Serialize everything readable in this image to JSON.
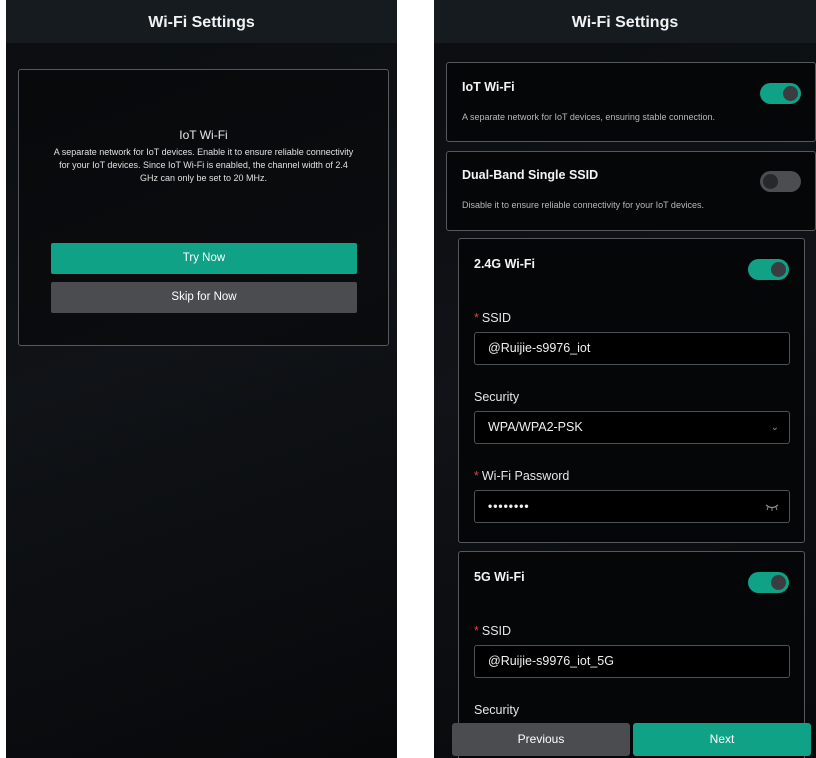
{
  "left": {
    "title": "Wi-Fi Settings",
    "card": {
      "heading": "IoT Wi-Fi",
      "description": "A separate network for IoT devices. Enable it to ensure reliable connectivity for your IoT devices. Since IoT Wi-Fi is enabled, the channel width of 2.4 GHz can only be set to 20 MHz."
    },
    "primary_button": "Try Now",
    "secondary_button": "Skip for Now"
  },
  "right": {
    "title": "Wi-Fi Settings",
    "iot": {
      "title": "IoT Wi-Fi",
      "description": "A separate network for IoT devices, ensuring stable connection.",
      "enabled": true
    },
    "dual_band": {
      "title": "Dual-Band Single SSID",
      "description": "Disable it to ensure reliable connectivity for your IoT devices.",
      "enabled": false
    },
    "wifi_24": {
      "title": "2.4G Wi-Fi",
      "enabled": true,
      "ssid_label": "SSID",
      "ssid_value": "@Ruijie-s9976_iot",
      "security_label": "Security",
      "security_value": "WPA/WPA2-PSK",
      "password_label": "Wi-Fi Password",
      "password_value": "••••••••"
    },
    "wifi_5": {
      "title": "5G Wi-Fi",
      "enabled": true,
      "ssid_label": "SSID",
      "ssid_value": "@Ruijie-s9976_iot_5G",
      "security_label": "Security"
    },
    "required_mark": "*",
    "previous_button": "Previous",
    "next_button": "Next"
  },
  "colors": {
    "accent": "#0fa287",
    "secondary_button": "#4a4c50",
    "title_bar": "#161b20",
    "required": "#e0453a"
  },
  "icons": [
    "chevron-down-icon",
    "eye-closed-icon"
  ]
}
